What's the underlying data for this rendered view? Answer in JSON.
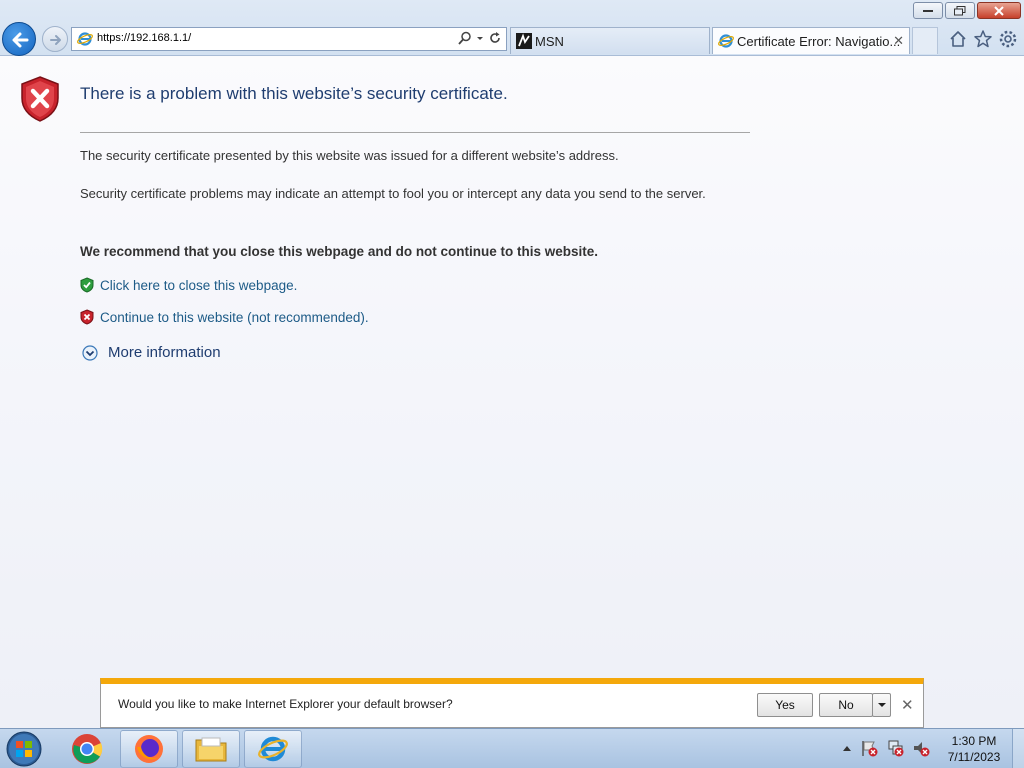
{
  "browser": {
    "address": {
      "url": "https://192.168.1.1/"
    },
    "tabs": [
      {
        "label": "MSN",
        "icon": "msn-icon"
      },
      {
        "label": "Certificate Error: Navigatio...",
        "icon": "ie-icon",
        "active": true
      }
    ]
  },
  "page": {
    "title": "There is a problem with this website’s security certificate.",
    "paragraph1": "The security certificate presented by this website was issued for a different website’s address.",
    "paragraph2": "Security certificate problems may indicate an attempt to fool you or intercept any data you send to the server.",
    "recommendation": "We recommend that you close this webpage and do not continue to this website.",
    "close_link": "Click here to close this webpage.",
    "continue_link": "Continue to this website (not recommended).",
    "more_info": "More information"
  },
  "notification": {
    "text": "Would you like to make Internet Explorer your default browser?",
    "yes_label": "Yes",
    "no_label": "No"
  },
  "taskbar": {
    "pinned": [
      "chrome-icon",
      "firefox-icon",
      "file-explorer-icon",
      "ie-icon"
    ],
    "clock": {
      "time": "1:30 PM",
      "date": "7/11/2023"
    }
  },
  "colors": {
    "title": "#1f3d70",
    "link": "#1d5b87",
    "notification_accent": "#f4a80b",
    "error_red": "#c8232c"
  }
}
